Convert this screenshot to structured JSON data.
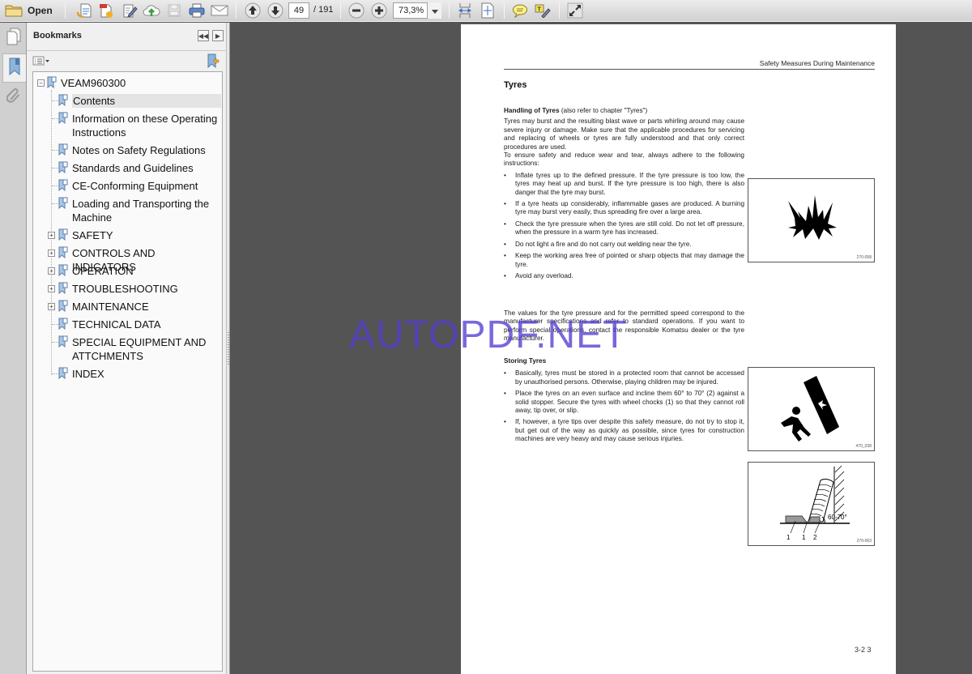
{
  "toolbar": {
    "open_label": "Open",
    "buttons": [
      "create-pdf",
      "export-pdf",
      "sign",
      "upload-to-cloud",
      "save",
      "print",
      "email",
      "previous-page",
      "next-page",
      "zoom-out",
      "zoom-in",
      "fit-width",
      "fit-page",
      "comment",
      "highlight-text",
      "full-screen"
    ],
    "page_current": "49",
    "page_total": "/ 191",
    "zoom_value": "73,3%"
  },
  "left_strip": {
    "items": [
      "page-thumbnails",
      "bookmarks",
      "attachments"
    ],
    "active": "bookmarks"
  },
  "bookmarks_panel": {
    "title": "Bookmarks",
    "root": "VEAM960300",
    "items": [
      {
        "label": "Contents",
        "expandable": false,
        "selected": true
      },
      {
        "label": "Information on these Operating Instructions",
        "expandable": false
      },
      {
        "label": "Notes on Safety Regulations",
        "expandable": false
      },
      {
        "label": "Standards and Guidelines",
        "expandable": false
      },
      {
        "label": "CE-Conforming Equipment",
        "expandable": false
      },
      {
        "label": "Loading and Transporting the Machine",
        "expandable": false
      },
      {
        "label": "SAFETY",
        "expandable": true
      },
      {
        "label": "CONTROLS AND INDICATORS",
        "expandable": true
      },
      {
        "label": "OPERATION",
        "expandable": true
      },
      {
        "label": "TROUBLESHOOTING",
        "expandable": true
      },
      {
        "label": "MAINTENANCE",
        "expandable": true
      },
      {
        "label": "TECHNICAL DATA",
        "expandable": false
      },
      {
        "label": "SPECIAL EQUIPMENT AND ATTCHMENTS",
        "expandable": false
      },
      {
        "label": "INDEX",
        "expandable": false
      }
    ]
  },
  "document": {
    "running_header": "Safety Measures During Maintenance",
    "title": "Tyres",
    "section1": {
      "heading": "Handling of Tyres",
      "heading_note": " (also refer to chapter \"Tyres\")",
      "intro": "Tyres may burst and the resulting blast wave or parts whirling around may cause severe injury or damage. Make sure that the applicable procedures for servicing and replacing of wheels or tyres are fully understood and that only correct procedures are used.",
      "intro2": "To ensure safety and reduce wear and tear, always adhere to the following instructions:",
      "bullets": [
        "Inflate tyres up to the defined pressure. If the tyre pressure is too low, the tyres may heat up and burst. If the tyre pressure is too high, there is also danger that the tyre may burst.",
        "If a tyre heats up considerably, inflammable gases are produced. A burning tyre may burst very easily, thus spreading fire over a large area.",
        "Check the tyre pressure when the tyres are still cold. Do not let off pressure, when the pressure in a warm tyre has increased.",
        "Do not light a fire and do not carry out welding near the tyre.",
        "Keep the working area free of pointed or sharp objects that may damage the tyre.",
        "Avoid any overload."
      ],
      "closing": "The values for the tyre pressure and for the permitted speed correspond to the manufacturer specifications and refer to standard operations. If you want to perform special operations, contact the responsible Komatsu dealer or the tyre manufacturer."
    },
    "section2": {
      "heading": "Storing Tyres",
      "bullets": [
        "Basically, tyres must be stored in a protected room that cannot be accessed by unauthorised persons. Otherwise, playing children may be injured.",
        "Place the tyres on an even surface and incline them 60° to 70° (2) against a solid stopper. Secure the tyres with wheel chocks (1) so that they cannot roll away, tip over, or slip.",
        "If, however, a tyre tips over despite this safety measure, do not try to stop it, but get out of the way as quickly as possible, since tyres for construction machines are very heavy and may cause serious injuries."
      ]
    },
    "figures": [
      {
        "id": "270-058",
        "depicts": "explosion"
      },
      {
        "id": "470_038",
        "depicts": "falling-object-person"
      },
      {
        "id": "270-063",
        "depicts": "tyre-storage",
        "labels": [
          "1",
          "1",
          "2"
        ],
        "angle": "60-70°"
      }
    ],
    "page_number": "3-2 3"
  },
  "watermark": "AUTOPDF.NET"
}
